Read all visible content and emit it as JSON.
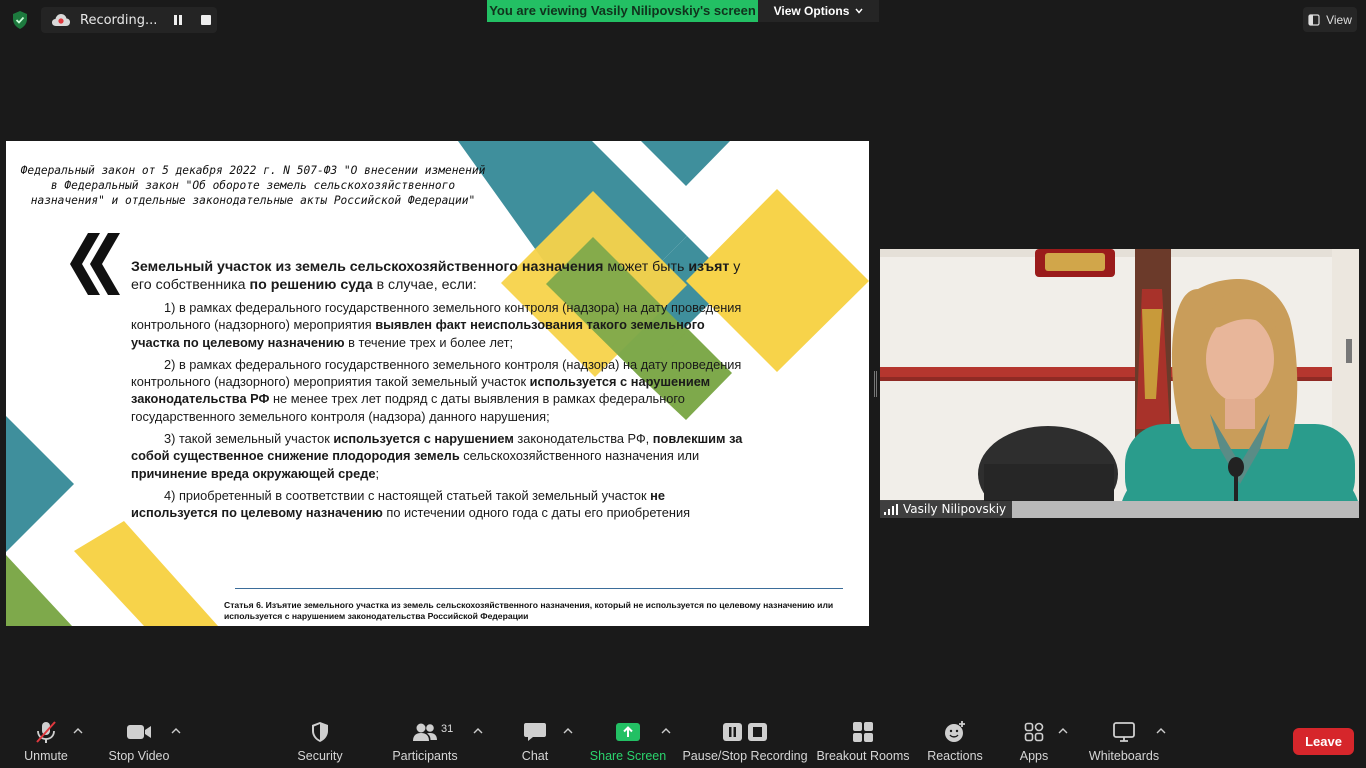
{
  "topbar": {
    "recording_label": "Recording...",
    "viewing_banner": "You are viewing Vasily Nilipovskiy's screen",
    "view_options_label": "View Options",
    "view_label": "View"
  },
  "slide": {
    "law_title": "Федеральный закон от 5 декабря 2022 г. N 507-ФЗ \"О внесении изменений в Федеральный закон \"Об обороте земель сельскохозяйственного назначения\" и отдельные законодательные акты Российской Федерации\"",
    "intro": {
      "p1_b": "Земельный участок из земель сельскохозяйственного назначения",
      "p2": " может быть ",
      "p3_b": "изъят",
      "p4": " у его собственника ",
      "p5_b": "по решению суда",
      "p6": " в случае, если:"
    },
    "item1": {
      "num": "1",
      "t1": ") в рамках федерального государственного земельного контроля (надзора) на дату проведения контрольного (надзорного) мероприятия ",
      "t2_b": "выявлен факт неиспользования такого земельного участка по целевому назначению",
      "t3": " в течение трех и более лет;"
    },
    "item2": {
      "num": "2",
      "t1": ") в рамках федерального государственного земельного контроля (надзора) на дату проведения контрольного (надзорного) мероприятия такой земельный участок ",
      "t2_b": "используется с нарушением законодательства РФ",
      "t3": " не менее трех лет подряд с даты выявления в рамках федерального государственного земельного контроля (надзора) данного нарушения;"
    },
    "item3": {
      "num": "3",
      "t1": ") такой земельный участок ",
      "t2_b": "используется с нарушением",
      "t3": " законодательства РФ, ",
      "t4_b": "повлекшим за собой существенное снижение плодородия земель",
      "t5": " сельскохозяйственного назначения или ",
      "t6_b": "причинение вреда окружающей среде",
      "t7": ";"
    },
    "item4": {
      "num": "4",
      "t1": ") приобретенный в соответствии с настоящей статьей такой земельный участок ",
      "t2_b": "не используется по целевому назначению",
      "t3": " по истечении одного года с даты его приобретения"
    },
    "footer": "Статья 6. Изъятие земельного участка из земель сельскохозяйственного назначения, который не используется по целевому назначению или используется с нарушением законодательства Российской Федерации"
  },
  "participant": {
    "name": "Vasily Nilipovskiy"
  },
  "toolbar": {
    "unmute": "Unmute",
    "stop_video": "Stop Video",
    "security": "Security",
    "participants": "Participants",
    "participants_count": "31",
    "chat": "Chat",
    "share_screen": "Share Screen",
    "pause_stop_recording": "Pause/Stop Recording",
    "breakout_rooms": "Breakout Rooms",
    "reactions": "Reactions",
    "apps": "Apps",
    "whiteboards": "Whiteboards",
    "leave": "Leave"
  },
  "colors": {
    "accent_green": "#23c064",
    "leave_red": "#d6262b",
    "slide_teal": "#3f8f9c",
    "slide_yellow": "#f7d34a",
    "slide_olive": "#7ea94b"
  }
}
